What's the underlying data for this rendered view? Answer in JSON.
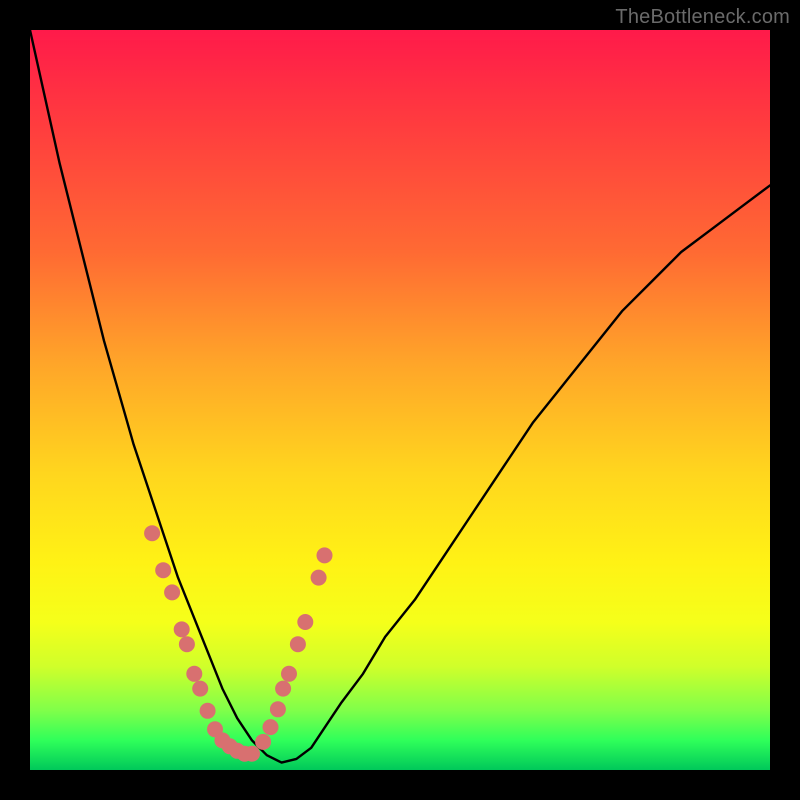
{
  "watermark": "TheBottleneck.com",
  "chart_data": {
    "type": "line",
    "title": "",
    "xlabel": "",
    "ylabel": "",
    "xlim": [
      0,
      100
    ],
    "ylim": [
      0,
      100
    ],
    "grid": false,
    "legend": false,
    "x": [
      0,
      2,
      4,
      6,
      8,
      10,
      12,
      14,
      16,
      18,
      20,
      22,
      24,
      26,
      28,
      30,
      32,
      34,
      36,
      38,
      40,
      42,
      45,
      48,
      52,
      56,
      60,
      64,
      68,
      72,
      76,
      80,
      84,
      88,
      92,
      96,
      100
    ],
    "series": [
      {
        "name": "bottleneck-curve",
        "values": [
          100,
          91,
          82,
          74,
          66,
          58,
          51,
          44,
          38,
          32,
          26,
          21,
          16,
          11,
          7,
          4,
          2,
          1,
          1.5,
          3,
          6,
          9,
          13,
          18,
          23,
          29,
          35,
          41,
          47,
          52,
          57,
          62,
          66,
          70,
          73,
          76,
          79
        ],
        "stroke": "#000000"
      }
    ],
    "scatter_points": {
      "color": "#d87070",
      "radius": 8,
      "points": [
        {
          "x": 16.5,
          "y": 32
        },
        {
          "x": 18.0,
          "y": 27
        },
        {
          "x": 19.2,
          "y": 24
        },
        {
          "x": 20.5,
          "y": 19
        },
        {
          "x": 21.2,
          "y": 17
        },
        {
          "x": 22.2,
          "y": 13
        },
        {
          "x": 23.0,
          "y": 11
        },
        {
          "x": 24.0,
          "y": 8
        },
        {
          "x": 25.0,
          "y": 5.5
        },
        {
          "x": 26.0,
          "y": 4
        },
        {
          "x": 27.0,
          "y": 3.2
        },
        {
          "x": 28.0,
          "y": 2.6
        },
        {
          "x": 29.0,
          "y": 2.2
        },
        {
          "x": 30.0,
          "y": 2.2
        },
        {
          "x": 31.5,
          "y": 3.8
        },
        {
          "x": 32.5,
          "y": 5.8
        },
        {
          "x": 33.5,
          "y": 8.2
        },
        {
          "x": 34.2,
          "y": 11
        },
        {
          "x": 35.0,
          "y": 13
        },
        {
          "x": 36.2,
          "y": 17
        },
        {
          "x": 37.2,
          "y": 20
        },
        {
          "x": 39.0,
          "y": 26
        },
        {
          "x": 39.8,
          "y": 29
        }
      ]
    },
    "gradient_background": {
      "orientation": "vertical",
      "stops": [
        {
          "pos": 0.0,
          "color": "#ff1a4a"
        },
        {
          "pos": 0.12,
          "color": "#ff3a3f"
        },
        {
          "pos": 0.3,
          "color": "#ff6a33"
        },
        {
          "pos": 0.45,
          "color": "#ffa529"
        },
        {
          "pos": 0.6,
          "color": "#ffd61e"
        },
        {
          "pos": 0.72,
          "color": "#fff215"
        },
        {
          "pos": 0.8,
          "color": "#f5ff1a"
        },
        {
          "pos": 0.86,
          "color": "#d0ff2a"
        },
        {
          "pos": 0.92,
          "color": "#7fff4a"
        },
        {
          "pos": 0.96,
          "color": "#2fff5a"
        },
        {
          "pos": 1.0,
          "color": "#00c85a"
        }
      ]
    }
  }
}
